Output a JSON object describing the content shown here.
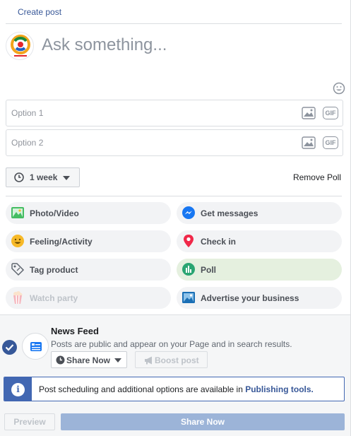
{
  "header": {
    "title": "Create post"
  },
  "composer": {
    "placeholder": "Ask something..."
  },
  "poll": {
    "options": [
      {
        "placeholder": "Option 1",
        "gif_label": "GIF"
      },
      {
        "placeholder": "Option 2",
        "gif_label": "GIF"
      }
    ],
    "duration": "1 week",
    "remove_label": "Remove Poll"
  },
  "actions": [
    {
      "label": "Photo/Video",
      "icon": "photo-icon"
    },
    {
      "label": "Get messages",
      "icon": "messenger-icon"
    },
    {
      "label": "Feeling/Activity",
      "icon": "smiley-icon"
    },
    {
      "label": "Check in",
      "icon": "location-pin-icon"
    },
    {
      "label": "Tag product",
      "icon": "tag-icon"
    },
    {
      "label": "Poll",
      "icon": "poll-icon",
      "active": true
    },
    {
      "label": "Watch party",
      "icon": "popcorn-icon",
      "disabled": true
    },
    {
      "label": "Advertise your business",
      "icon": "ad-icon"
    }
  ],
  "audience": {
    "title": "News Feed",
    "description": "Posts are public and appear on your Page and in search results.",
    "share_option": "Share Now",
    "boost_label": "Boost post"
  },
  "info_banner": {
    "text": "Post scheduling and additional options are available in ",
    "link": "Publishing tools."
  },
  "footer": {
    "preview_label": "Preview",
    "share_label": "Share Now"
  },
  "colors": {
    "brand": "#4267b2",
    "link": "#385898",
    "poll_active": "#e5f0df",
    "share_disabled": "#9cb4d8"
  }
}
